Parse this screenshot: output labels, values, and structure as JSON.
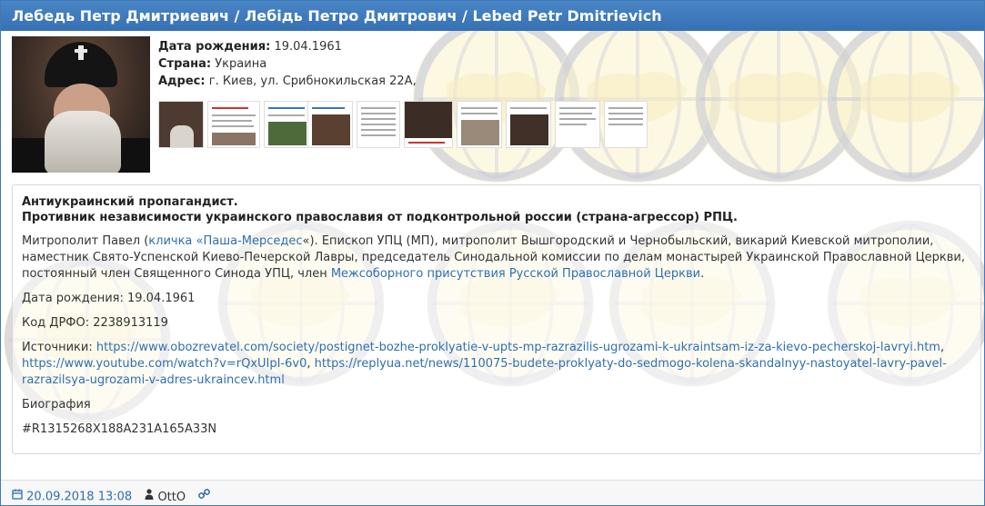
{
  "header": {
    "title": "Лебедь Петр Дмитриевич / Лебідь Петро Дмитрович / Lebed Petr Dmitrievich"
  },
  "profile": {
    "birth_label": "Дата рождения:",
    "birth_value": "19.04.1961",
    "country_label": "Страна:",
    "country_value": "Украина",
    "address_label": "Адрес:",
    "address_value": "г. Киев, ул. Срибнокильская 22А,"
  },
  "body": {
    "lead1": "Антиукраинский пропагандист.",
    "lead2": "Противник независимости украинского православия от подконтрольной россии (страна-агрессор) РПЦ.",
    "bio_p1_a": "Митрополит Павел (",
    "bio_p1_link1": "кличка «Паша-Мерседес",
    "bio_p1_b": "«). Епископ УПЦ (МП), митрополит Вышгородский и Чернобыльский, викарий Киевской митрополии, наместник Свято-Успенской Киево-Печерской Лавры, председатель Синодальной комиссии по делам монастырей Украинской Православной Церкви, постоянный член Священного Синода УПЦ, член ",
    "bio_p1_link2": "Межсоборного присутствия Русской Православной Церкви",
    "bio_p1_c": ".",
    "birth_line": "Дата рождения: 19.04.1961",
    "drfo_line": "Код ДРФО: 2238913119",
    "sources_label": "Источники: ",
    "source1": "https://www.obozrevatel.com/society/postignet-bozhe-proklyatie-v-upts-mp-razrazilis-ugrozami-k-ukraintsam-iz-za-kievo-pecherskoj-lavryi.htm",
    "source_sep": ",",
    "source2": "https://www.youtube.com/watch?v=rQxUIpI-6v0",
    "source_sep2": ", ",
    "source3": "https://replyua.net/news/110075-budete-proklyaty-do-sedmogo-kolena-skandalnyy-nastoyatel-lavry-pavel-razrazilsya-ugrozami-v-adres-ukraincev.html",
    "bio_heading": "Биография",
    "hash_code": "#R1315268X188A231A165A33N"
  },
  "watermark": {
    "top_text": "МИРОТВОРЕЦЬ",
    "bottom_text": "PRO BONO PUBLICO"
  },
  "footer": {
    "date": "20.09.2018 13:08",
    "user": "OttO"
  },
  "colors": {
    "header_bg": "#3a77b8",
    "link": "#2f6fb0",
    "watermark_navy": "#1f2f7a",
    "watermark_yellow": "#f1d23a"
  }
}
